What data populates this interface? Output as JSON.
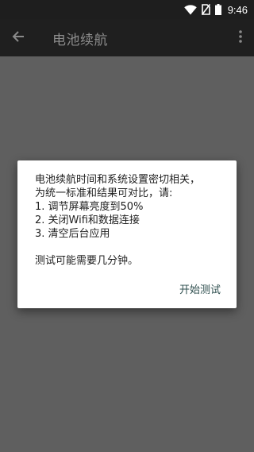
{
  "status_bar": {
    "time": "9:46",
    "icons": [
      "wifi-icon",
      "no-sim-icon",
      "battery-icon"
    ]
  },
  "toolbar": {
    "title": "电池续航",
    "back_icon": "arrow-left-icon",
    "overflow_icon": "more-vert-icon"
  },
  "dialog": {
    "message_lines": [
      "电池续航时间和系统设置密切相关，",
      "为统一标准和结果可对比，请:",
      "1. 调节屏幕亮度到50%",
      "2. 关闭Wifi和数据连接",
      "3. 清空后台应用"
    ],
    "note": "测试可能需要几分钟。",
    "action_label": "开始测试"
  },
  "colors": {
    "status_bar_bg": "#1e1e1e",
    "toolbar_bg": "#1f1f1f",
    "scrim": "#5f5f5f",
    "dialog_bg": "#ffffff",
    "action_text": "#2f4f4f"
  }
}
